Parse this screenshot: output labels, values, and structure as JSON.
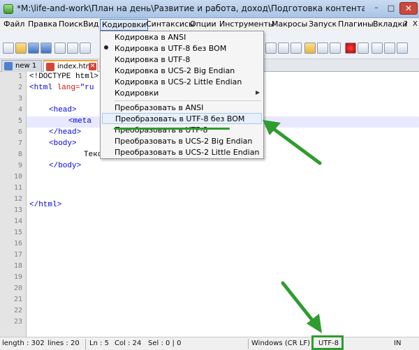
{
  "window": {
    "title": "*M:\\life-and-work\\План на день\\Развитие и работа, доход\\Подготовка контента\\Webdeco\\создани...",
    "minimize": "–",
    "maximize": "□",
    "close": "✕"
  },
  "menubar": {
    "items": [
      "Файл",
      "Правка",
      "Поиск",
      "Вид",
      "Кодировки",
      "Синтаксисы",
      "Опции",
      "Инструменты",
      "Макросы",
      "Запуск",
      "Плагины",
      "Вкладки",
      "?"
    ],
    "active_item": "Кодировки",
    "close_glyph": "X"
  },
  "tabs": [
    {
      "label": "new 1",
      "active": false
    },
    {
      "label": "index.html",
      "active": true
    }
  ],
  "editor": {
    "line_numbers": [
      "1",
      "2",
      "3",
      "4",
      "5",
      "6",
      "7",
      "8",
      "9",
      "10",
      "11",
      "12",
      "13",
      "14",
      "15",
      "16",
      "17",
      "18",
      "19",
      "20",
      "21",
      "22",
      "23"
    ],
    "lines": {
      "l1": "<!DOCTYPE html>",
      "l2_tag": "<html ",
      "l2_attr": "lang=",
      "l2_val": "\"ru",
      "l4": "<head>",
      "l5": "<meta",
      "l6": "</head>",
      "l7": "<body>",
      "l8": "Текс",
      "l9": "</body>",
      "l12": "</html>"
    },
    "current_line": 5
  },
  "encoding_menu": {
    "items": [
      {
        "label": "Кодировка в ANSI",
        "selected": false
      },
      {
        "label": "Кодировка в UTF-8 без BOM",
        "selected": true
      },
      {
        "label": "Кодировка в UTF-8",
        "selected": false
      },
      {
        "label": "Кодировка в UCS-2 Big Endian",
        "selected": false
      },
      {
        "label": "Кодировка в UCS-2 Little Endian",
        "selected": false
      },
      {
        "label": "Кодировки",
        "selected": false,
        "submenu": true
      },
      {
        "label": "Преобразовать в ANSI",
        "selected": false
      },
      {
        "label": "Преобразовать в UTF-8 без BOM",
        "selected": false,
        "highlighted": true
      },
      {
        "label": "Преобразовать в UTF-8",
        "selected": false
      },
      {
        "label": "Преобразовать в UCS-2 Big Endian",
        "selected": false
      },
      {
        "label": "Преобразовать в UCS-2 Little Endian",
        "selected": false
      }
    ],
    "submenu_arrow": "▶"
  },
  "statusbar": {
    "length": "length : 302",
    "lines": "lines : 20",
    "ln": "Ln : 5",
    "col": "Col : 24",
    "sel": "Sel : 0 | 0",
    "eol": "Windows (CR LF)",
    "encoding": "UTF-8",
    "mode": "IN"
  },
  "colors": {
    "annotation_green": "#2e9c2e",
    "tag_blue": "#0000e0",
    "attr_red": "#d01010",
    "close_red": "#c94a3c"
  }
}
